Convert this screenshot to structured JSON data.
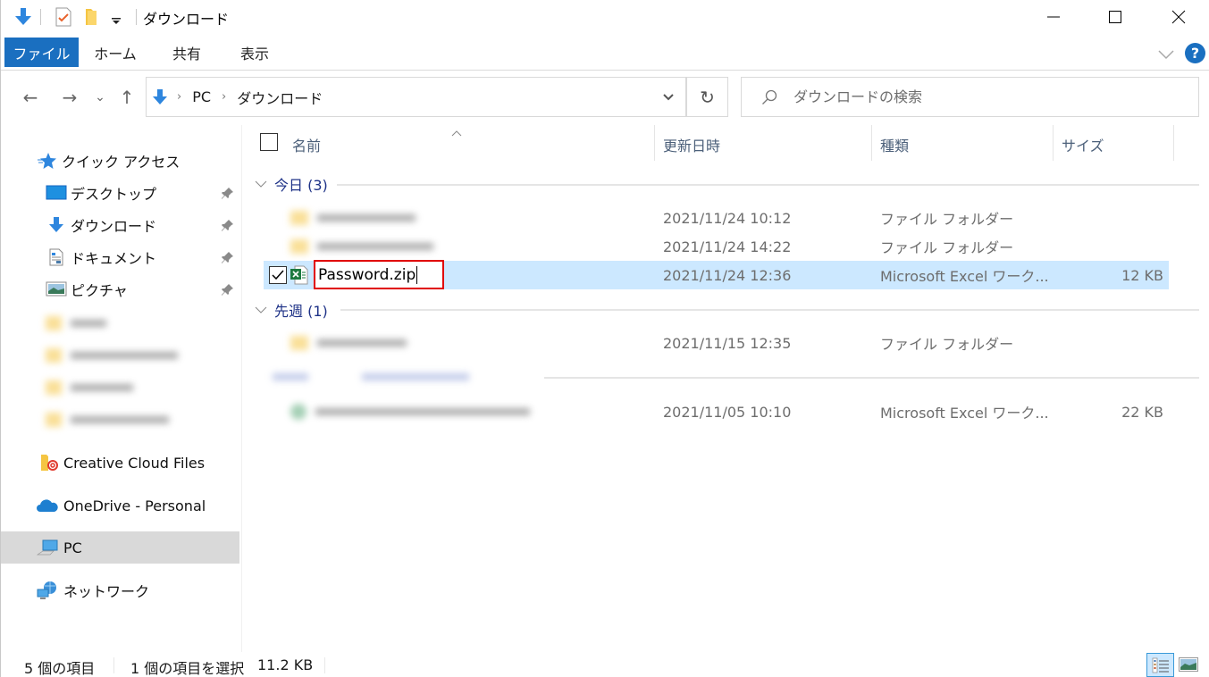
{
  "window": {
    "title": "ダウンロード",
    "controls": {
      "minimize": "minimize-icon",
      "maximize": "maximize-icon",
      "close": "close-icon"
    }
  },
  "quick_access_toolbar": {
    "icons": [
      "download-arrow-icon",
      "properties-check-icon",
      "new-folder-icon",
      "customize-dropdown-icon"
    ]
  },
  "ribbon": {
    "tabs": [
      {
        "label": "ファイル",
        "active": true
      },
      {
        "label": "ホーム"
      },
      {
        "label": "共有"
      },
      {
        "label": "表示"
      }
    ],
    "expand_icon": "chevron-down-icon",
    "help_icon": "help-icon",
    "help_label": "?"
  },
  "navigation": {
    "back": "←",
    "forward": "→",
    "recent": "⌄",
    "up": "↑",
    "breadcrumb": [
      "PC",
      "ダウンロード"
    ],
    "breadcrumb_sep": "›",
    "refresh": "↻"
  },
  "search": {
    "placeholder": "ダウンロードの検索"
  },
  "sidebar": {
    "quick_access": {
      "label": "クイック アクセス"
    },
    "pinned": [
      {
        "label": "デスクトップ",
        "icon": "desktop-icon"
      },
      {
        "label": "ダウンロード",
        "icon": "download-icon"
      },
      {
        "label": "ドキュメント",
        "icon": "documents-icon"
      },
      {
        "label": "ピクチャ",
        "icon": "pictures-icon"
      }
    ],
    "locations": [
      {
        "label": "Creative Cloud Files",
        "icon": "creative-cloud-icon"
      },
      {
        "label": "OneDrive - Personal",
        "icon": "onedrive-icon"
      },
      {
        "label": "PC",
        "icon": "pc-icon",
        "selected": true
      },
      {
        "label": "ネットワーク",
        "icon": "network-icon"
      }
    ]
  },
  "columns": {
    "name": "名前",
    "modified": "更新日時",
    "type": "種類",
    "size": "サイズ"
  },
  "groups": [
    {
      "label": "今日 (3)",
      "rows": [
        {
          "name": "",
          "modified": "2021/11/24 10:12",
          "type": "ファイル フォルダー",
          "size": "",
          "icon": "folder-icon",
          "blurred": true
        },
        {
          "name": "",
          "modified": "2021/11/24 14:22",
          "type": "ファイル フォルダー",
          "size": "",
          "icon": "folder-icon",
          "blurred": true
        },
        {
          "name": "Password.zip",
          "modified": "2021/11/24 12:36",
          "type": "Microsoft Excel ワーク...",
          "size": "12 KB",
          "icon": "excel-file-icon",
          "selected": true,
          "renaming": true
        }
      ]
    },
    {
      "label": "先週 (1)",
      "rows": [
        {
          "name": "",
          "modified": "2021/11/15 12:35",
          "type": "ファイル フォルダー",
          "size": "",
          "icon": "folder-icon",
          "blurred": true
        }
      ]
    },
    {
      "label": "",
      "blurred": true,
      "rows": [
        {
          "name": "",
          "modified": "2021/11/05 10:10",
          "type": "Microsoft Excel ワーク...",
          "size": "22 KB",
          "icon": "excel-file-icon",
          "blurred": true
        }
      ]
    }
  ],
  "status": {
    "item_count": "5 個の項目",
    "selection": "1 個の項目を選択",
    "selection_size": "11.2 KB"
  },
  "view_toggles": [
    {
      "icon": "details-view-icon",
      "active": true
    },
    {
      "icon": "large-icons-view-icon",
      "active": false
    }
  ],
  "colors": {
    "accent": "#1a6fc0",
    "selection": "#cce8ff",
    "group_header": "#1e3287",
    "rename_border": "#e00000",
    "sidebar_selected": "#d9d9d9"
  }
}
